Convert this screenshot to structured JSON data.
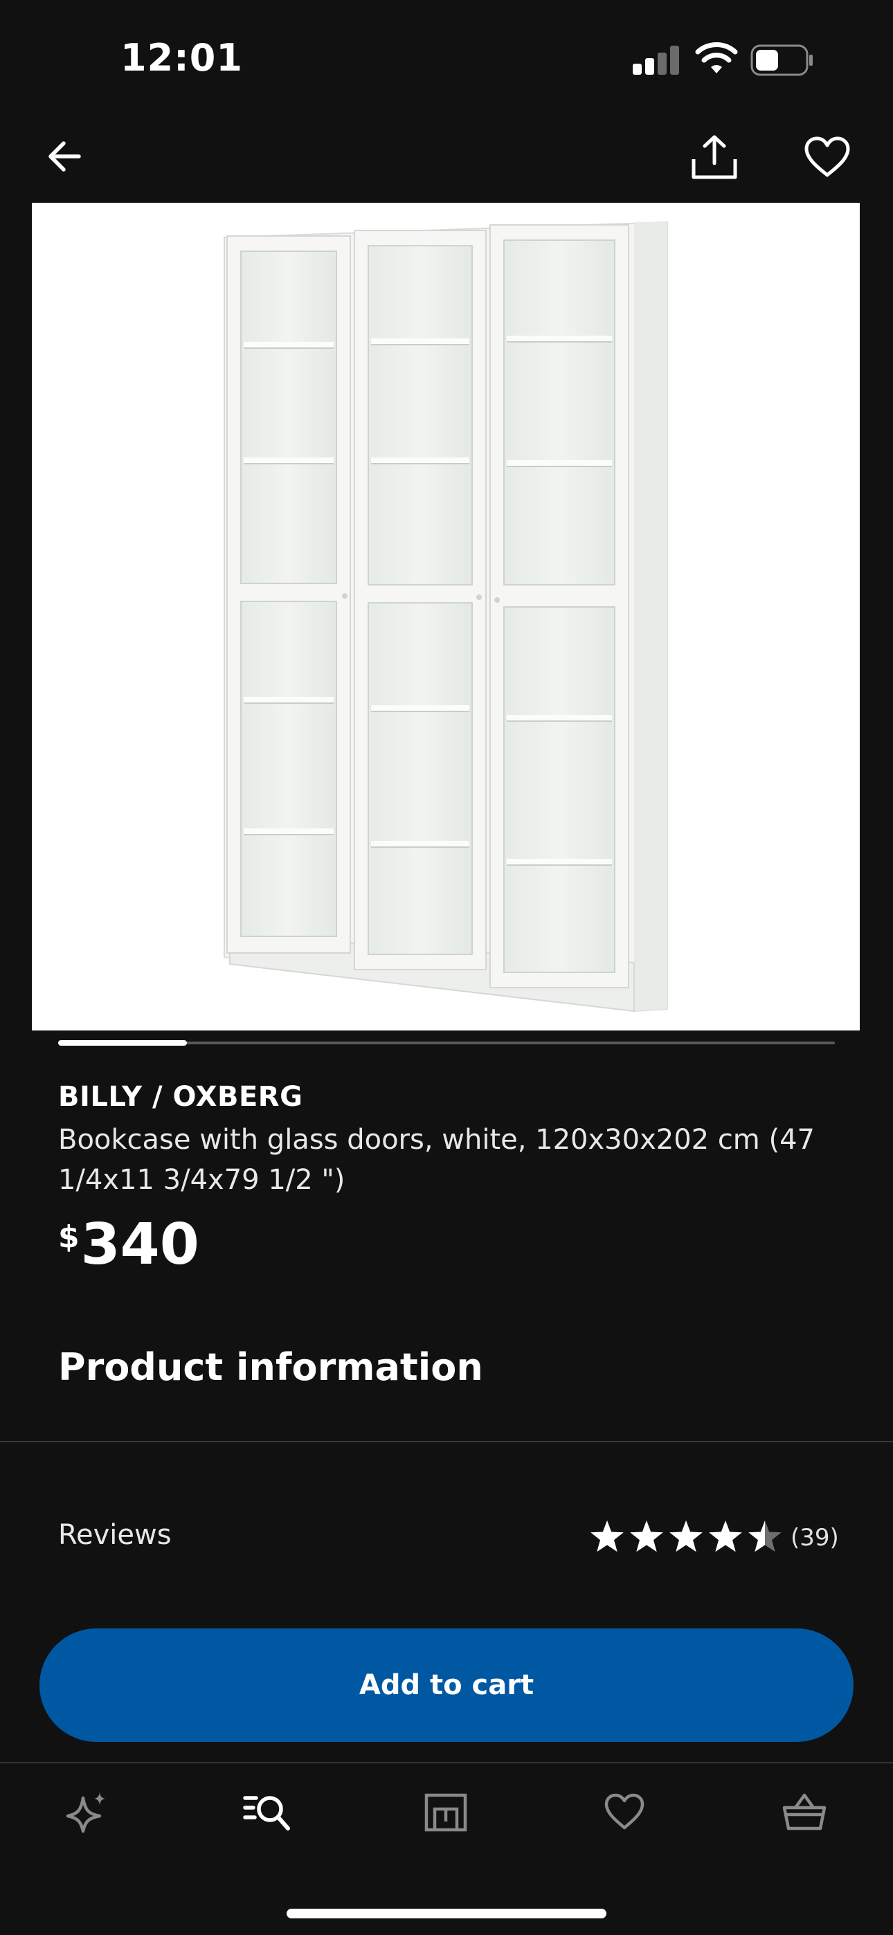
{
  "status_bar": {
    "time": "12:01",
    "icons": [
      "signal-icon",
      "wifi-icon",
      "battery-icon"
    ]
  },
  "nav": {
    "icons": [
      "back-arrow-icon",
      "share-icon",
      "heart-icon"
    ]
  },
  "carousel": {
    "current_index": 1,
    "progress_fraction": 0.166
  },
  "product": {
    "name": "BILLY / OXBERG",
    "description": "Bookcase with glass doors, white, 120x30x202 cm (47 1/4x11 3/4x79 1/2 \")",
    "price_currency": "$",
    "price_amount": "340"
  },
  "sections": {
    "product_info_title": "Product information"
  },
  "reviews": {
    "label": "Reviews",
    "rating": 4.5,
    "max_rating": 5,
    "count": "(39)"
  },
  "cta": {
    "add_to_cart_label": "Add to cart"
  },
  "tabbar": {
    "items": [
      "sparkle-icon",
      "search-icon",
      "store-icon",
      "heart-icon",
      "basket-icon"
    ],
    "active": "search-icon"
  },
  "colors": {
    "background": "#111111",
    "accent": "#0058a3",
    "text": "#ffffff",
    "muted_icon": "#8a8a8a"
  }
}
